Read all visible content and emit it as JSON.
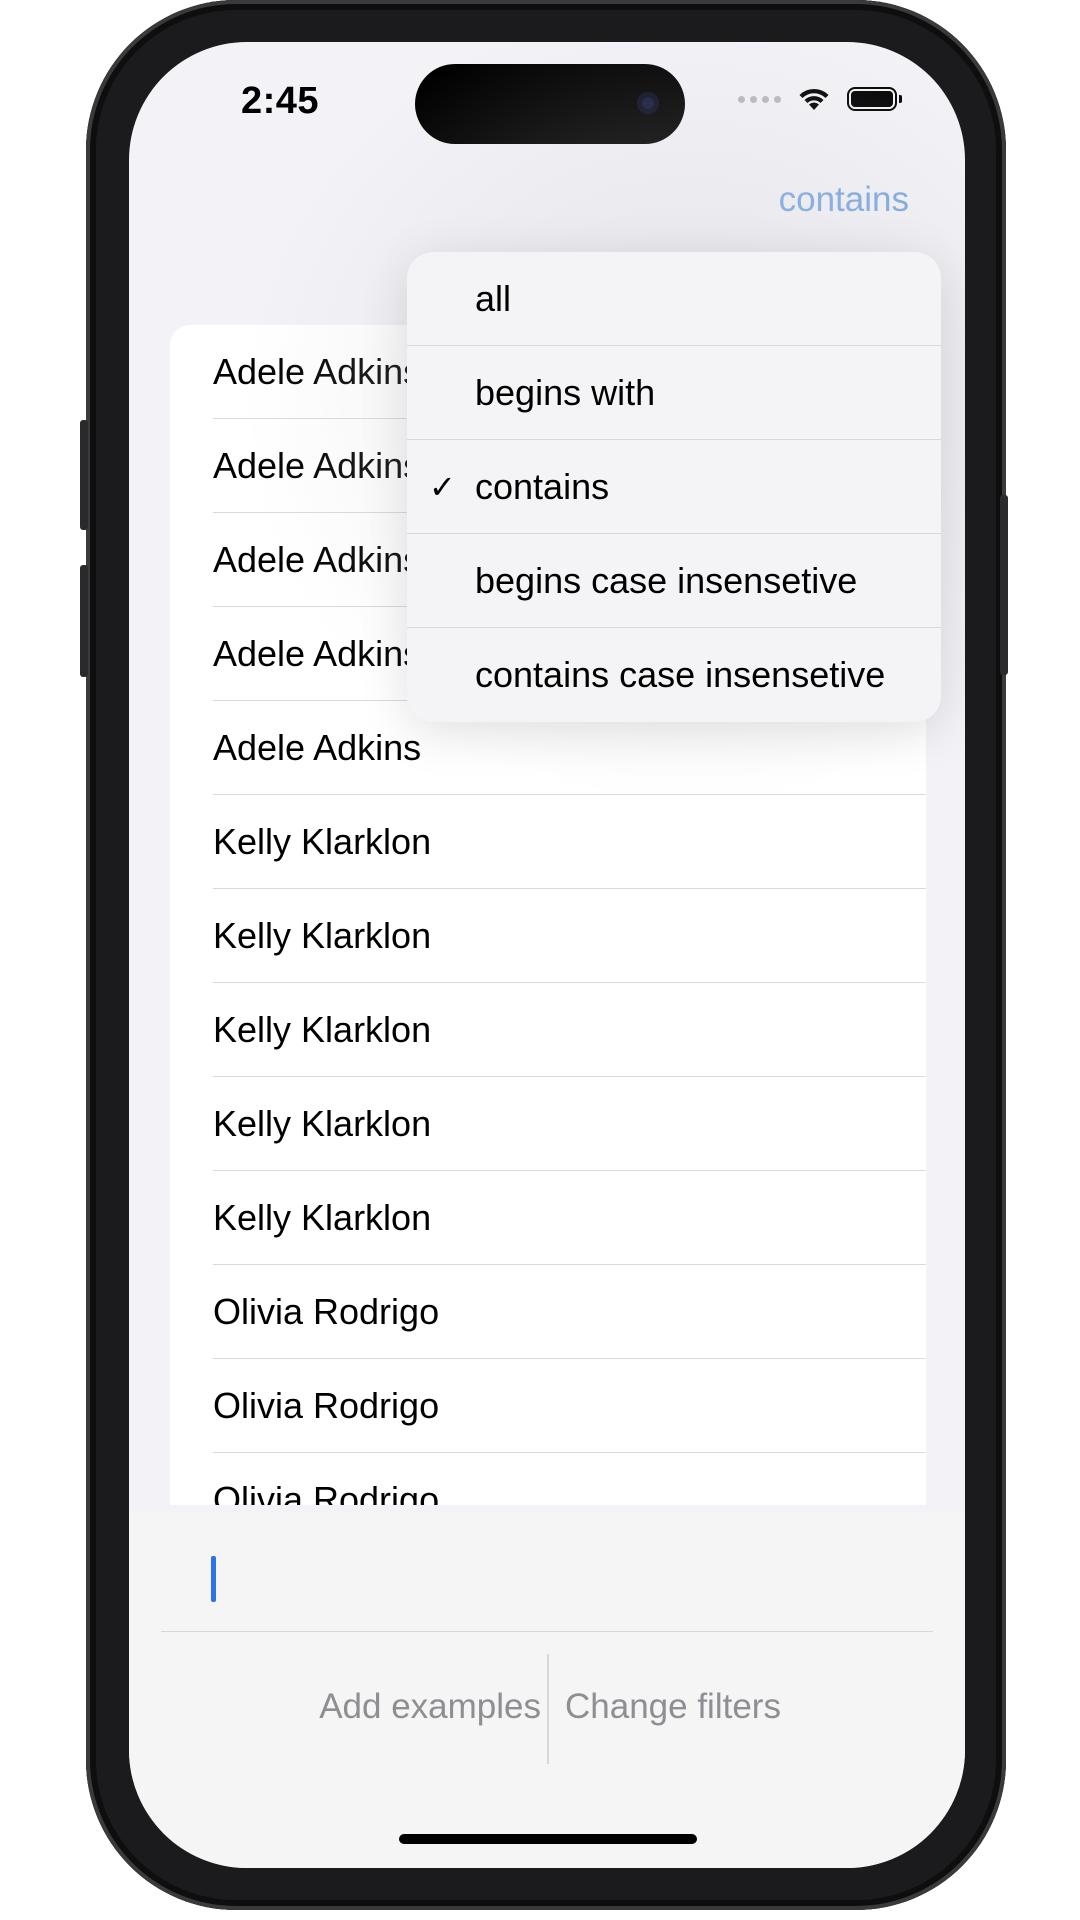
{
  "status_bar": {
    "time": "2:45"
  },
  "nav": {
    "filter_button_label": "contains"
  },
  "list": {
    "rows": [
      "Adele Adkins",
      "Adele Adkins",
      "Adele Adkins",
      "Adele Adkins",
      "Adele Adkins",
      "Kelly Klarklon",
      "Kelly Klarklon",
      "Kelly Klarklon",
      "Kelly Klarklon",
      "Kelly Klarklon",
      "Olivia Rodrigo",
      "Olivia Rodrigo",
      "Olivia Rodrigo"
    ]
  },
  "menu": {
    "items": [
      {
        "label": "all",
        "checked": false
      },
      {
        "label": "begins with",
        "checked": false
      },
      {
        "label": "contains",
        "checked": true
      },
      {
        "label": "begins case insensetive",
        "checked": false
      },
      {
        "label": "contains case insensetive",
        "checked": false
      }
    ],
    "check_glyph": "✓"
  },
  "bottom": {
    "input_value": "",
    "add_examples_label": "Add examples",
    "change_filters_label": "Change filters"
  },
  "colors": {
    "accent": "#7aa7e0",
    "cursor": "#2f74e6",
    "secondary_text": "#8e8e93"
  },
  "icons": {
    "wifi": "wifi-icon",
    "battery": "battery-icon",
    "signal": "cellular-signal-icon",
    "check": "checkmark-icon"
  }
}
